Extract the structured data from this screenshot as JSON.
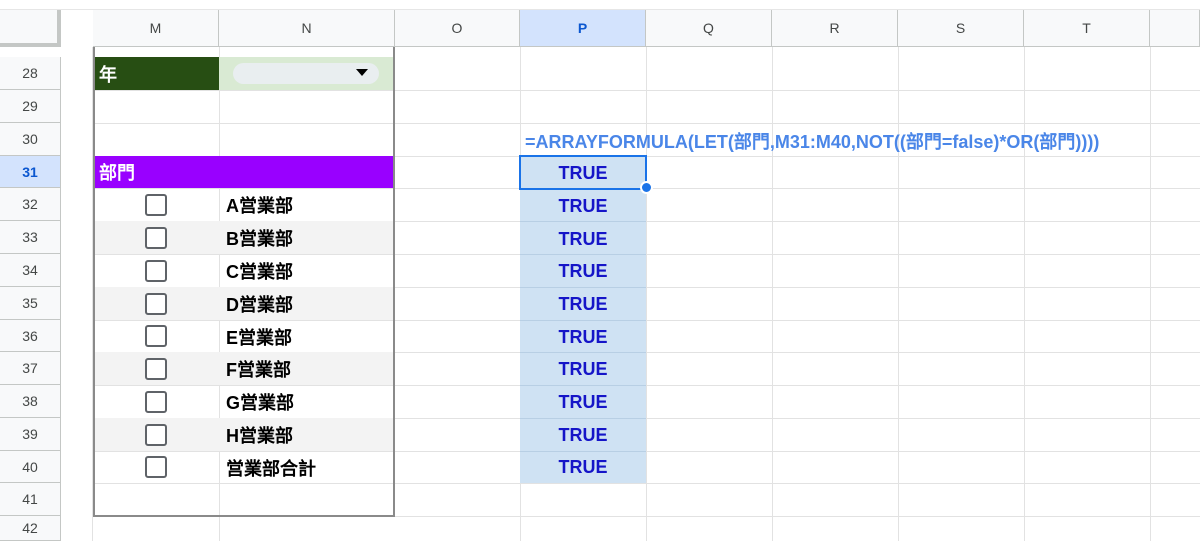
{
  "columns": {
    "M": "M",
    "N": "N",
    "O": "O",
    "P": "P",
    "Q": "Q",
    "R": "R",
    "S": "S",
    "T": "T"
  },
  "rows": [
    "28",
    "29",
    "30",
    "31",
    "32",
    "33",
    "34",
    "35",
    "36",
    "37",
    "38",
    "39",
    "40",
    "41",
    "42"
  ],
  "selected_cell": "P31",
  "sheet": {
    "year_label": "年",
    "year_dropdown_value": "",
    "department_header": "部門",
    "departments": [
      "A営業部",
      "B営業部",
      "C営業部",
      "D営業部",
      "E営業部",
      "F営業部",
      "G営業部",
      "H営業部",
      "営業部合計"
    ],
    "checkboxes_checked": [
      false,
      false,
      false,
      false,
      false,
      false,
      false,
      false,
      false
    ],
    "formula": "=ARRAYFORMULA(LET(部門,M31:M40,NOT((部門=false)*OR(部門))))",
    "results": [
      "TRUE",
      "TRUE",
      "TRUE",
      "TRUE",
      "TRUE",
      "TRUE",
      "TRUE",
      "TRUE",
      "TRUE",
      "TRUE"
    ]
  },
  "colors": {
    "year_header_bg": "#274e13",
    "dropdown_bg": "#d9ead3",
    "department_header_bg": "#9900ff",
    "result_column_bg": "#cfe2f3",
    "result_text": "#1515c8",
    "formula_text": "#4a86e8",
    "selection": "#1a73e8"
  }
}
